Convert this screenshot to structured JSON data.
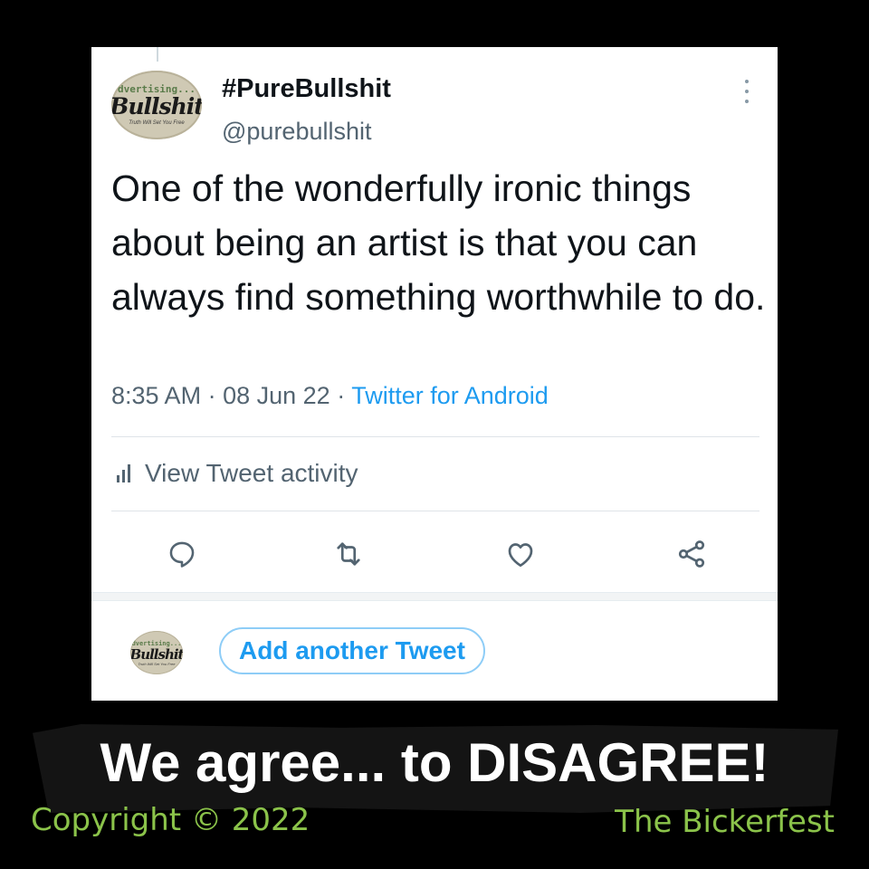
{
  "tweet": {
    "avatar": {
      "top": "dvertising...",
      "mid": "Bullshit",
      "bottom": "Truth Will Set You Free"
    },
    "display_name": "#PureBullshit",
    "handle": "@purebullshit",
    "text": "One of the wonderfully ironic things about being an artist is that you can always find something worthwhile to do.",
    "time": "8:35 AM",
    "date": "08 Jun 22",
    "source": "Twitter for Android",
    "activity_label": "View Tweet activity",
    "actions": [
      {
        "name": "reply-icon"
      },
      {
        "name": "retweet-icon"
      },
      {
        "name": "like-icon"
      },
      {
        "name": "share-icon"
      }
    ]
  },
  "composer": {
    "avatar": {
      "top": "dvertising...",
      "mid": "Bullshit",
      "bottom": "Truth Will Set You Free"
    },
    "add_tweet_label": "Add another Tweet"
  },
  "footer": {
    "slogan": "We agree... to DISAGREE!",
    "copyright": "Copyright © 2022",
    "brand": "The Bickerfest"
  },
  "colors": {
    "accent": "#1d9bf0",
    "secondary_text": "#536471",
    "footer_green": "#8bc34a",
    "background": "#000000"
  }
}
